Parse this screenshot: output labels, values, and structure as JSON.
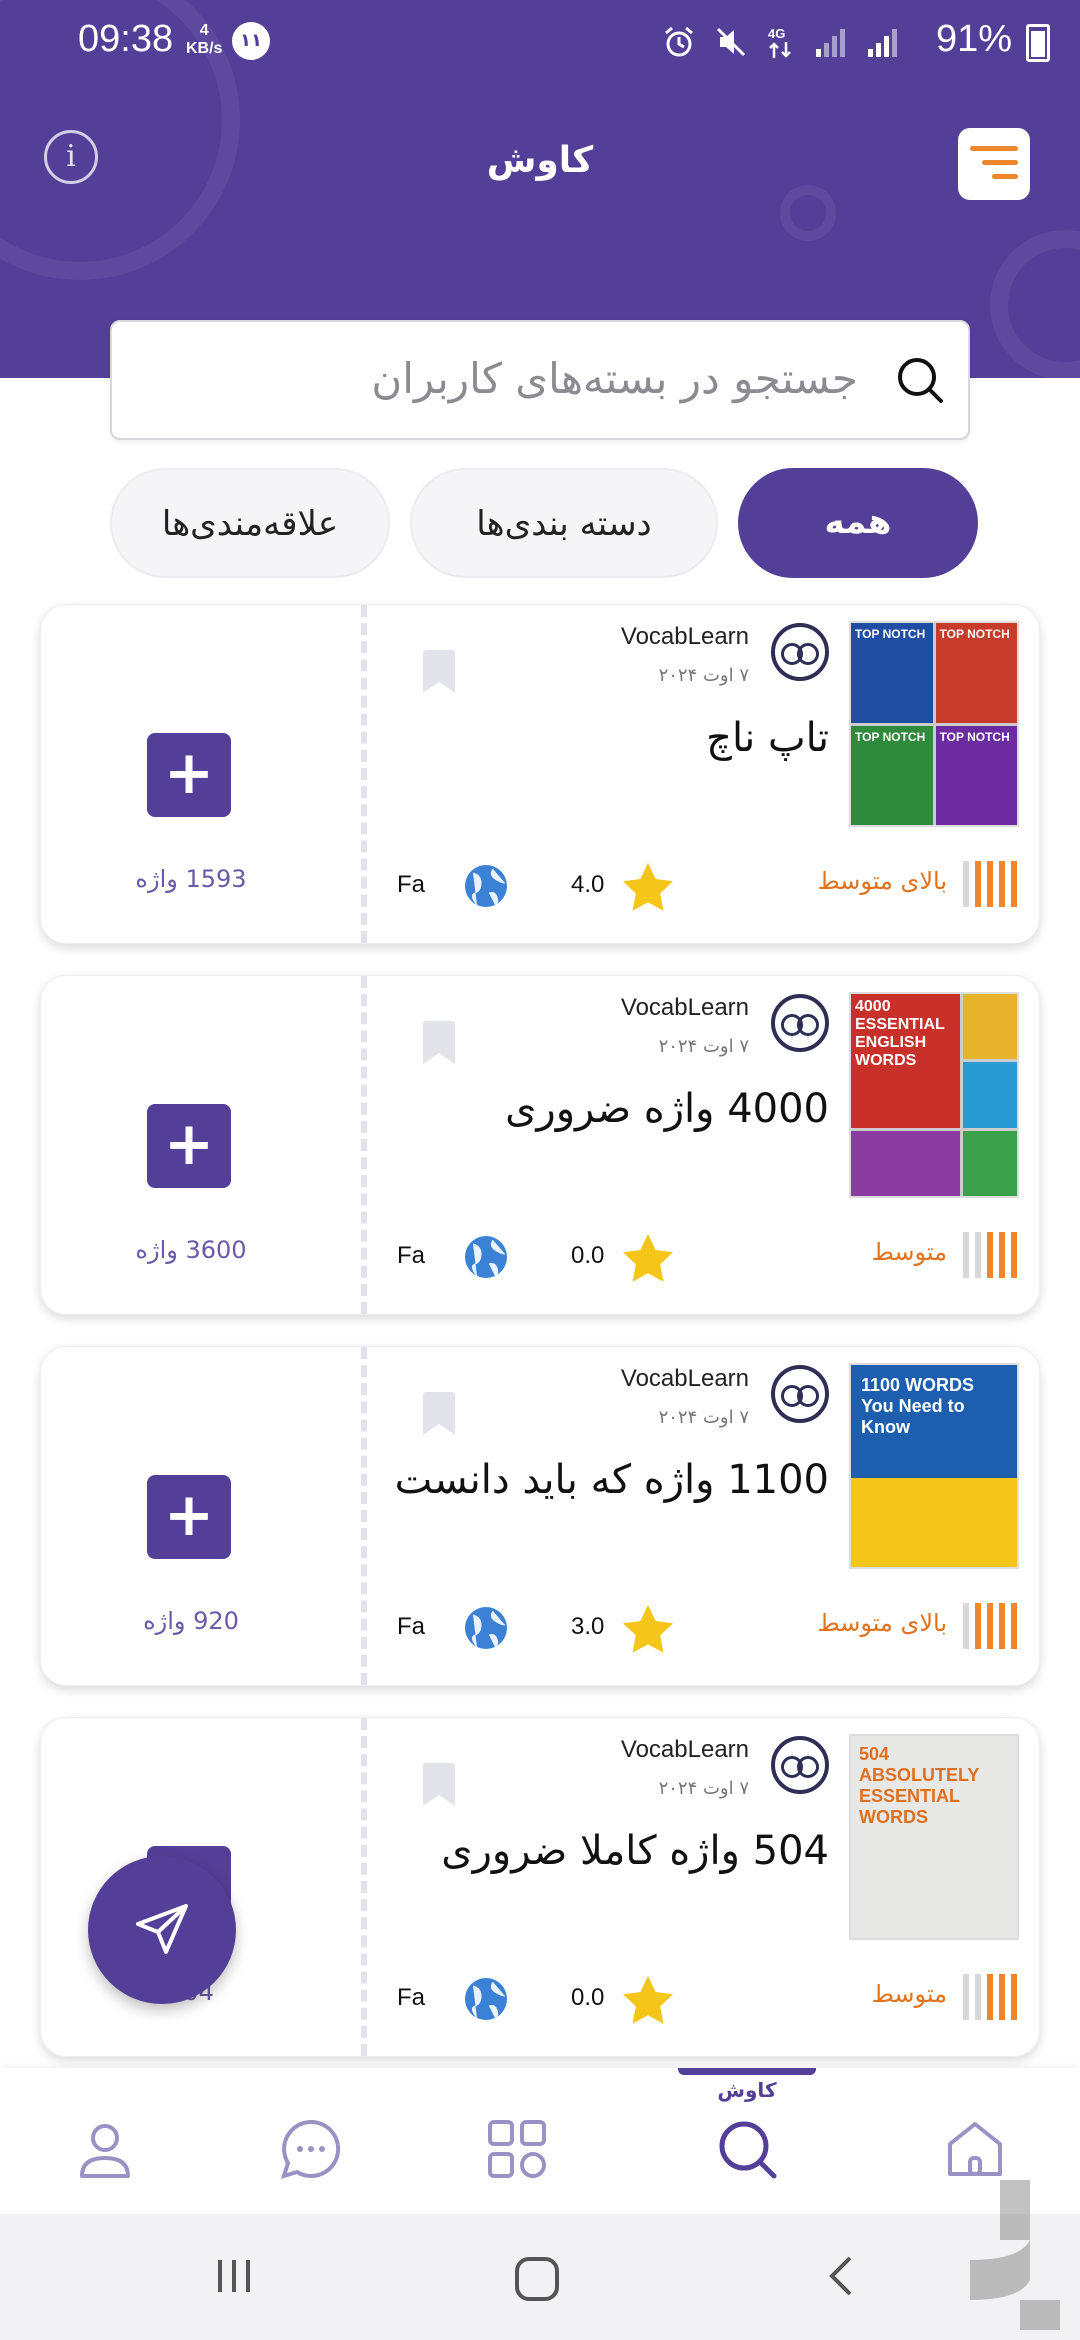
{
  "status_bar": {
    "time": "09:38",
    "speed_value": "4",
    "speed_unit": "KB/s",
    "badge": "۱۱",
    "battery": "91%"
  },
  "header": {
    "title": "کاوش",
    "info_label": "i"
  },
  "search": {
    "placeholder": "جستجو در بسته‌های کاربران"
  },
  "filters": [
    {
      "label": "همه",
      "active": true
    },
    {
      "label": "دسته بندی‌ها",
      "active": false
    },
    {
      "label": "علاقه‌مندی‌ها",
      "active": false
    }
  ],
  "cards": [
    {
      "title": "تاپ ناچ",
      "author": "VocabLearn",
      "date": "۷ اوت ۲۰۲۴",
      "level": "بالای متوسط",
      "rating": "4.0",
      "language": "Fa",
      "word_count": "1593 واژه",
      "cover": "TOP NOTCH"
    },
    {
      "title": "4000 واژه ضروری",
      "author": "VocabLearn",
      "date": "۷ اوت ۲۰۲۴",
      "level": "متوسط",
      "rating": "0.0",
      "language": "Fa",
      "word_count": "3600 واژه",
      "cover": "4000 ESSENTIAL ENGLISH WORDS"
    },
    {
      "title": "1100 واژه که باید دانست",
      "author": "VocabLearn",
      "date": "۷ اوت ۲۰۲۴",
      "level": "بالای متوسط",
      "rating": "3.0",
      "language": "Fa",
      "word_count": "920 واژه",
      "cover": "1100 WORDS You Need to Know"
    },
    {
      "title": "504 واژه کاملا ضروری",
      "author": "VocabLearn",
      "date": "۷ اوت ۲۰۲۴",
      "level": "متوسط",
      "rating": "0.0",
      "language": "Fa",
      "word_count": "504",
      "cover": "504 ABSOLUTELY ESSENTIAL WORDS"
    }
  ],
  "add_label": "+",
  "bottom_nav": {
    "active_label": "کاوش",
    "items": [
      "profile-icon",
      "chat-icon",
      "grid-icon",
      "search-icon",
      "home-icon"
    ]
  },
  "colors": {
    "primary": "#533f98",
    "accent": "#f0862b",
    "star": "#f5c518"
  }
}
